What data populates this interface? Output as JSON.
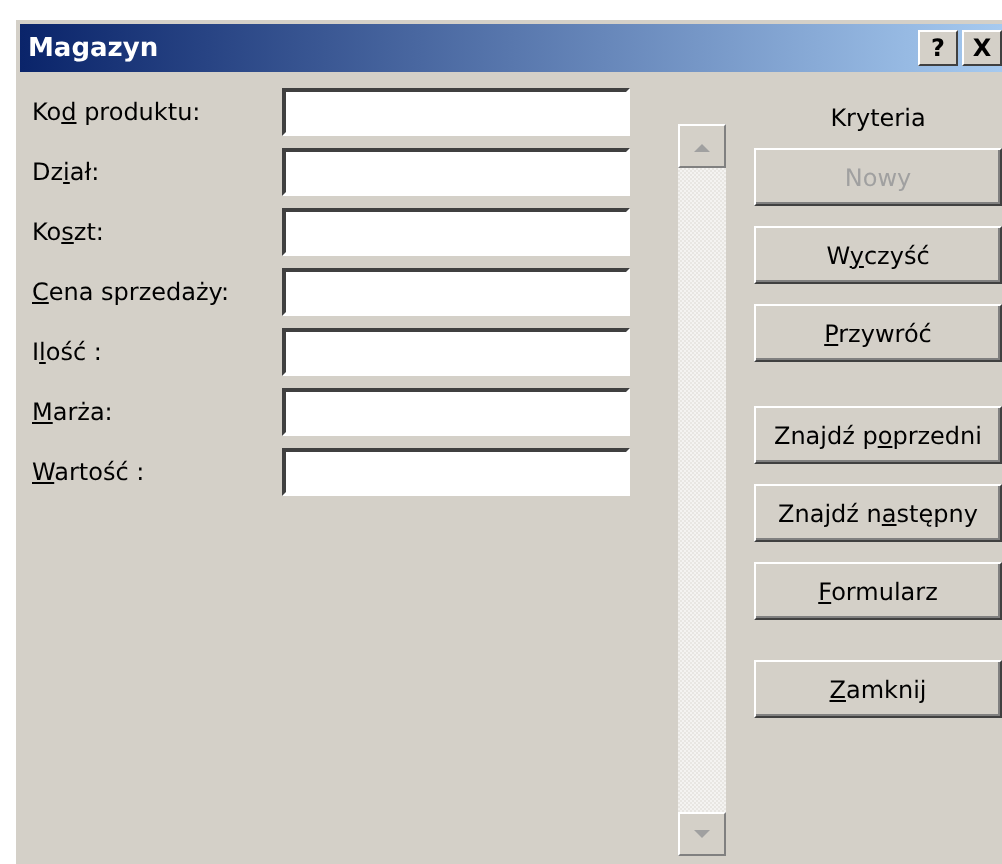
{
  "window": {
    "title": "Magazyn",
    "controls": [
      "?",
      "X"
    ]
  },
  "fields": [
    {
      "label": {
        "pre": "Ko",
        "key": "d",
        "post": " produktu:"
      }
    },
    {
      "label": {
        "pre": "Dz",
        "key": "i",
        "post": "ał:"
      }
    },
    {
      "label": {
        "pre": "Ko",
        "key": "s",
        "post": "zt:"
      }
    },
    {
      "label": {
        "key": "C",
        "post": "ena sprzedaży:"
      }
    },
    {
      "label": {
        "pre": "I",
        "key": "l",
        "post": "ość :"
      }
    },
    {
      "label": {
        "key": "M",
        "post": "arża:"
      }
    },
    {
      "label": {
        "key": "W",
        "post": "artość :"
      }
    }
  ],
  "criteria_label": "Kryteria",
  "buttons": [
    {
      "label": {
        "pre": "Nowy"
      },
      "disabled": true
    },
    {
      "label": {
        "pre": "W",
        "key": "y",
        "post": "czyść"
      },
      "disabled": false
    },
    {
      "label": {
        "key": "P",
        "post": "rzywróć"
      },
      "disabled": false
    },
    {
      "label": {
        "pre": "Znajdź p",
        "key": "o",
        "post": "przedni"
      },
      "disabled": false
    },
    {
      "label": {
        "pre": "Znajdź n",
        "key": "a",
        "post": "stępny"
      },
      "disabled": false
    },
    {
      "label": {
        "key": "F",
        "post": "ormularz"
      },
      "disabled": false
    },
    {
      "label": {
        "key": "Z",
        "post": "amknij"
      },
      "disabled": false
    }
  ]
}
